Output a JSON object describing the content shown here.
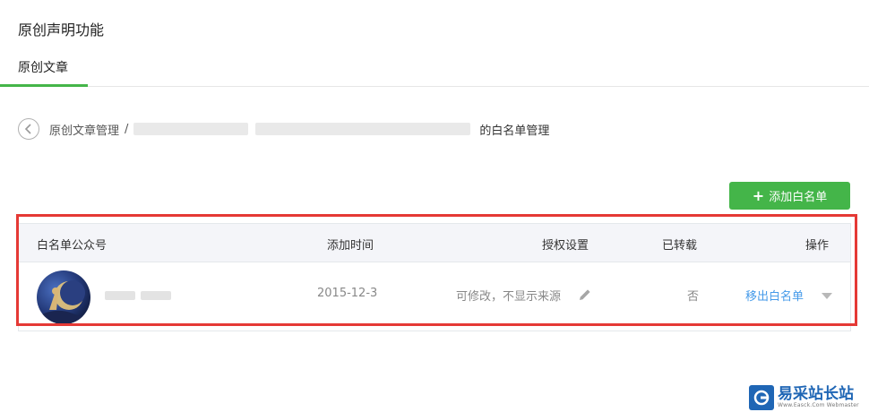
{
  "header": {
    "title": "原创声明功能"
  },
  "tabs": [
    {
      "label": "原创文章",
      "active": true
    }
  ],
  "breadcrumb": {
    "parent": "原创文章管理",
    "separator": "/",
    "current_suffix": "的白名单管理"
  },
  "actions": {
    "add_whitelist": "添加白名单"
  },
  "table": {
    "columns": {
      "account": "白名单公众号",
      "added_time": "添加时间",
      "permission": "授权设置",
      "reposted": "已转载",
      "actions": "操作"
    },
    "rows": [
      {
        "added_time": "2015-12-3",
        "permission": "可修改，不显示来源",
        "reposted": "否",
        "action_label": "移出白名单"
      }
    ]
  },
  "watermark": {
    "title": "易采站长站",
    "subtitle": "Www.Easck.Com Webmaster"
  },
  "colors": {
    "accent": "#44b549",
    "link": "#459ae9",
    "highlight_box": "#e53935"
  }
}
